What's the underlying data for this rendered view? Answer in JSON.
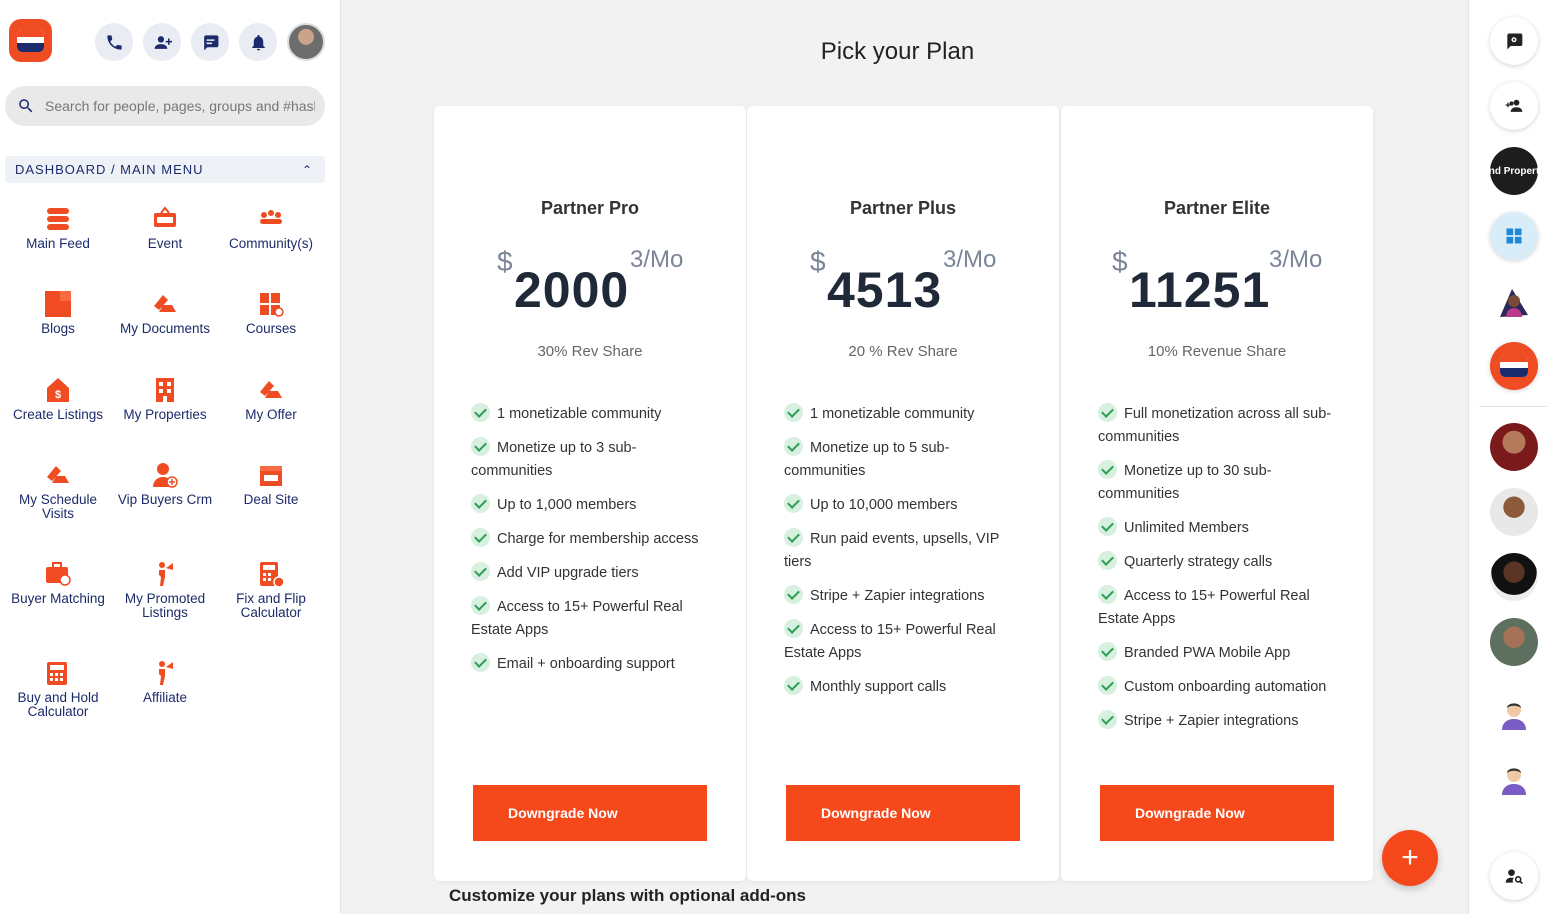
{
  "app": {
    "brand_color": "#f04c23",
    "navy": "#1c2b6b"
  },
  "header": {
    "icons": [
      "phone-icon",
      "add-user-icon",
      "chat-icon",
      "bell-icon"
    ]
  },
  "search": {
    "placeholder": "Search for people, pages, groups and #hashtags"
  },
  "menu": {
    "title": "DASHBOARD / MAIN MENU",
    "items": [
      {
        "label": "Main Feed",
        "icon": "main-feed-icon"
      },
      {
        "label": "Event",
        "icon": "event-icon"
      },
      {
        "label": "Community(s)",
        "icon": "community-icon"
      },
      {
        "label": "Blogs",
        "icon": "blogs-icon"
      },
      {
        "label": "My Documents",
        "icon": "documents-icon"
      },
      {
        "label": "Courses",
        "icon": "courses-icon"
      },
      {
        "label": "Create Listings",
        "icon": "create-listings-icon"
      },
      {
        "label": "My Properties",
        "icon": "properties-icon"
      },
      {
        "label": "My Offer",
        "icon": "offer-icon"
      },
      {
        "label": "My Schedule Visits",
        "icon": "schedule-icon"
      },
      {
        "label": "Vip Buyers Crm",
        "icon": "vip-buyers-icon"
      },
      {
        "label": "Deal Site",
        "icon": "deal-site-icon"
      },
      {
        "label": "Buyer Matching",
        "icon": "buyer-matching-icon"
      },
      {
        "label": "My Promoted Listings",
        "icon": "promoted-listings-icon"
      },
      {
        "label": "Fix and Flip Calculator",
        "icon": "calculator-icon"
      },
      {
        "label": "Buy and Hold Calculator",
        "icon": "calculator-icon"
      },
      {
        "label": "Affiliate",
        "icon": "affiliate-icon"
      }
    ]
  },
  "main": {
    "title": "Pick your Plan",
    "addons_heading": "Customize your plans with optional add-ons",
    "plans": [
      {
        "name": "Partner Pro",
        "currency": "$",
        "price": "2000",
        "period": "3/Mo",
        "share": "30% Rev Share",
        "features": [
          "1 monetizable community",
          "Monetize up to 3 sub-communities",
          "Up to 1,000 members",
          "Charge for membership access",
          "Add VIP upgrade tiers",
          "Access to 15+ Powerful Real Estate Apps",
          "Email + onboarding support"
        ],
        "cta": "Downgrade Now"
      },
      {
        "name": "Partner Plus",
        "currency": "$",
        "price": "4513",
        "period": "3/Mo",
        "share": "20 % Rev Share",
        "features": [
          "1 monetizable community",
          "Monetize up to 5 sub-communities",
          "Up to 10,000 members",
          "Run paid events, upsells, VIP tiers",
          "Stripe + Zapier integrations",
          "Access to 15+ Powerful Real Estate Apps",
          "Monthly support calls"
        ],
        "cta": "Downgrade Now"
      },
      {
        "name": "Partner Elite",
        "currency": "$",
        "price": "11251",
        "period": "3/Mo",
        "share": "10% Revenue Share",
        "features": [
          "Full monetization across all sub-communities",
          "Monetize up to 30 sub-communities",
          "Unlimited Members",
          "Quarterly strategy calls",
          "Access to 15+ Powerful Real Estate Apps",
          "Branded PWA Mobile App",
          "Custom onboarding automation",
          "Stripe + Zapier integrations"
        ],
        "cta": "Downgrade Now"
      }
    ]
  },
  "fab": {
    "label": "+"
  },
  "rail": {
    "group_thumb_text": "nd Propert"
  }
}
